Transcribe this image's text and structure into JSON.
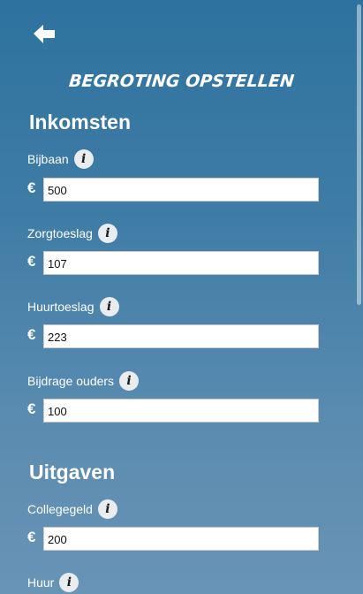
{
  "header": {
    "back_icon": "back-arrow-icon",
    "title": "Begroting opstellen"
  },
  "income": {
    "title": "Inkomsten",
    "fields": [
      {
        "label": "Bijbaan",
        "currency": "€",
        "value": "500"
      },
      {
        "label": "Zorgtoeslag",
        "currency": "€",
        "value": "107"
      },
      {
        "label": "Huurtoeslag",
        "currency": "€",
        "value": "223"
      },
      {
        "label": "Bijdrage ouders",
        "currency": "€",
        "value": "100"
      }
    ]
  },
  "expenses": {
    "title": "Uitgaven",
    "fields": [
      {
        "label": "Collegegeld",
        "currency": "€",
        "value": "200"
      },
      {
        "label": "Huur"
      }
    ]
  },
  "info_icon_text": "i",
  "colors": {
    "background_top": "#2e729f",
    "background_bottom": "#6894b6",
    "info_badge": "#e9edf0"
  }
}
